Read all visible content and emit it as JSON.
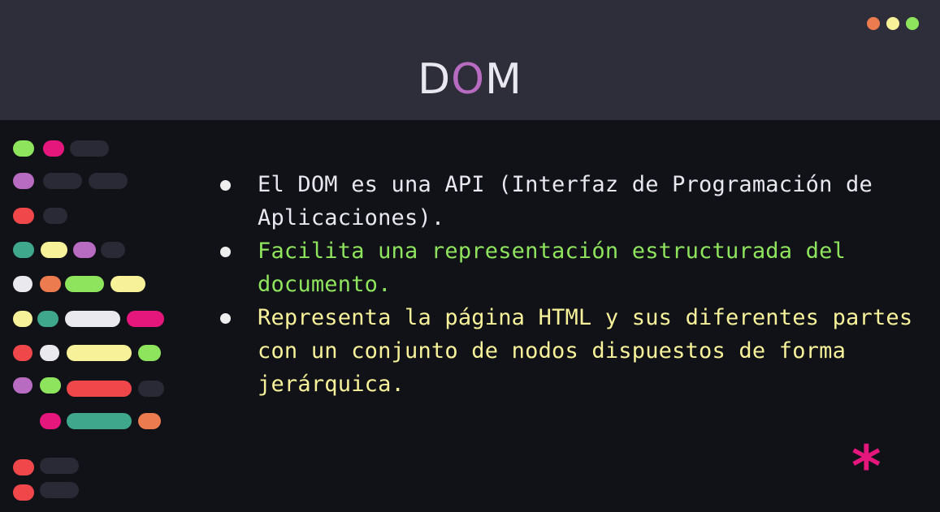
{
  "title": {
    "prefix": "D",
    "accent": "O",
    "suffix": "M"
  },
  "colors": {
    "header_bg": "#2e2d3a",
    "body_bg": "#111118",
    "title_accent": "#b86cc1",
    "bullet1": "#e9e7ef",
    "bullet2": "#8ee55d",
    "bullet3": "#f7f29a",
    "asterisk": "#e5167c"
  },
  "window_dots": [
    {
      "name": "window-dot-orange",
      "color": "#ec7b4f"
    },
    {
      "name": "window-dot-yellow",
      "color": "#f7f29a"
    },
    {
      "name": "window-dot-green",
      "color": "#8ee55d"
    }
  ],
  "bullets": [
    {
      "text": "El DOM es una API (Interfaz de Programación de Aplicaciones).",
      "color": "#e9e7ef"
    },
    {
      "text": "Facilita una representación estructurada del documento.",
      "color": "#8ee55d"
    },
    {
      "text": "Representa la página HTML y sus diferentes partes con un conjunto de nodos dispuestos de forma jerárquica.",
      "color": "#f7f29a"
    }
  ],
  "decor": {
    "asterisk": "*"
  }
}
